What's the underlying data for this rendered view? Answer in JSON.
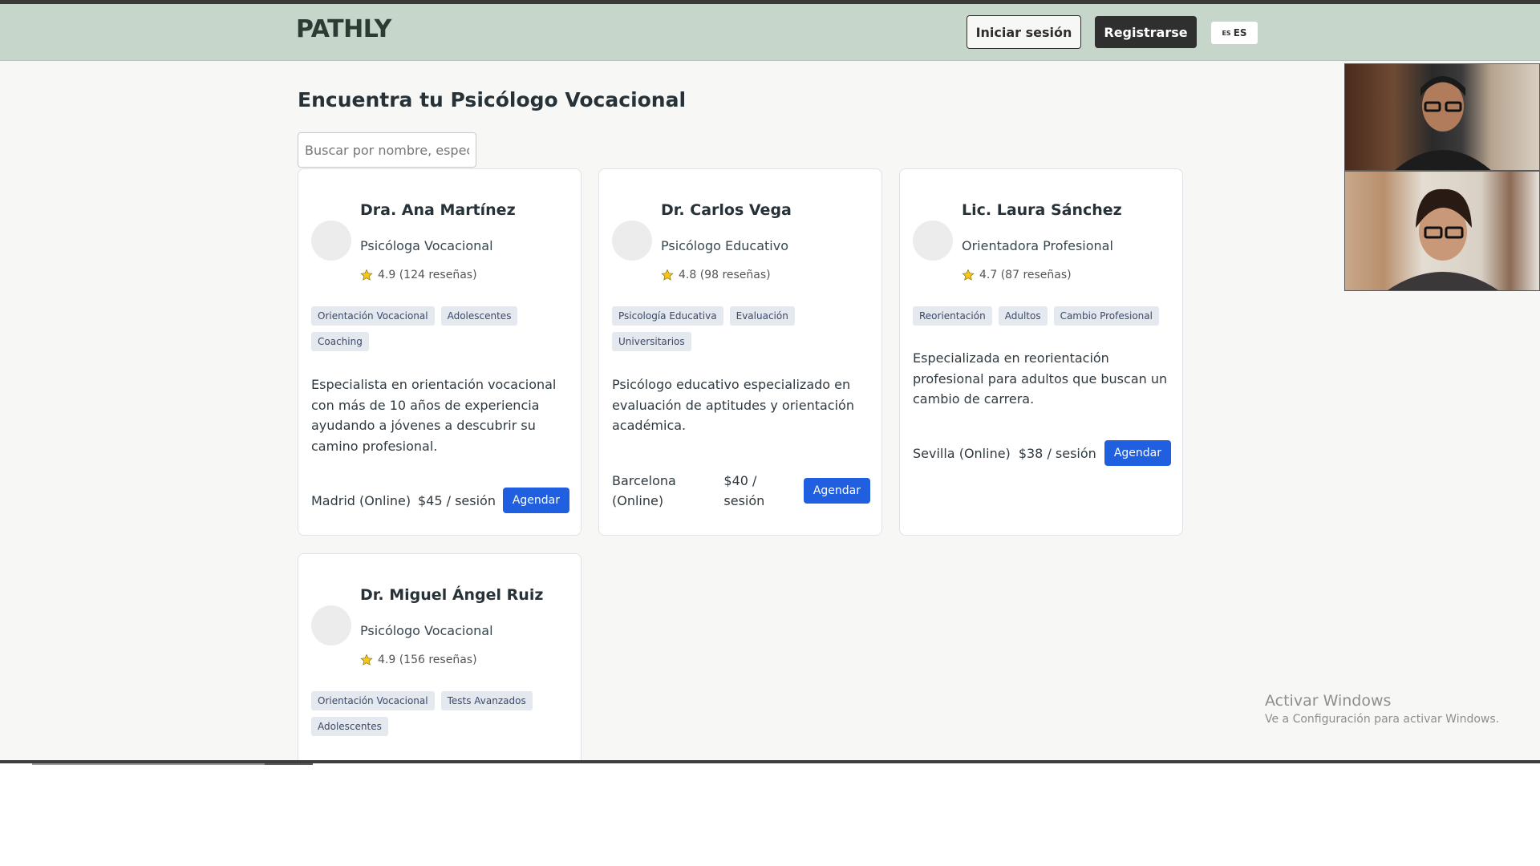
{
  "app": {
    "logo": "PATHLY"
  },
  "nav": {
    "login": "Iniciar sesión",
    "register": "Registrarse",
    "lang_small": "ES",
    "lang": "ES"
  },
  "page": {
    "title": "Encuentra tu Psicólogo Vocacional",
    "search_placeholder": "Buscar por nombre, especialidad..."
  },
  "psychologists": [
    {
      "name": "Dra. Ana Martínez",
      "role": "Psicóloga Vocacional",
      "rating": "4.9 (124 reseñas)",
      "tags": [
        "Orientación Vocacional",
        "Adolescentes",
        "Coaching"
      ],
      "description": "Especialista en orientación vocacional con más de 10 años de experiencia ayudando a jóvenes a descubrir su camino profesional.",
      "location": "Madrid (Online)",
      "price": "$45 / sesión",
      "book": "Agendar"
    },
    {
      "name": "Dr. Carlos Vega",
      "role": "Psicólogo Educativo",
      "rating": "4.8 (98 reseñas)",
      "tags": [
        "Psicología Educativa",
        "Evaluación",
        "Universitarios"
      ],
      "description": "Psicólogo educativo especializado en evaluación de aptitudes y orientación académica.",
      "location": "Barcelona (Online)",
      "price": "$40 / sesión",
      "book": "Agendar"
    },
    {
      "name": "Lic. Laura Sánchez",
      "role": "Orientadora Profesional",
      "rating": "4.7 (87 reseñas)",
      "tags": [
        "Reorientación",
        "Adultos",
        "Cambio Profesional"
      ],
      "description": "Especializada en reorientación profesional para adultos que buscan un cambio de carrera.",
      "location": "Sevilla (Online)",
      "price": "$38 / sesión",
      "book": "Agendar"
    },
    {
      "name": "Dr. Miguel Ángel Ruiz",
      "role": "Psicólogo Vocacional",
      "rating": "4.9 (156 reseñas)",
      "tags": [
        "Orientación Vocacional",
        "Tests Avanzados",
        "Adolescentes"
      ]
    }
  ],
  "watermark": {
    "title": "Activar Windows",
    "subtitle": "Ve a Configuración para activar Windows."
  },
  "colors": {
    "nav_bg": "#c6d6cb",
    "accent": "#1f5fe0",
    "tag_bg": "#e4e8ef",
    "star": "#f5c518"
  }
}
